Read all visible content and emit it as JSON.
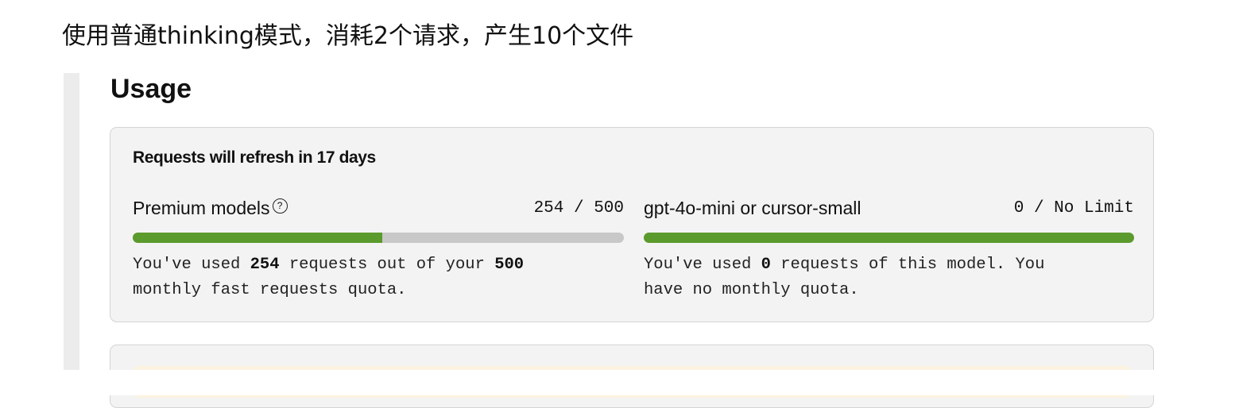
{
  "caption": "使用普通thinking模式，消耗2个请求，产生10个文件",
  "usage": {
    "title": "Usage",
    "refresh_text": "Requests will refresh in 17 days",
    "premium": {
      "name": "Premium models",
      "help_icon": "?",
      "count": "254 / 500",
      "progress_fraction": 0.508,
      "desc_line1_pre": "You've used ",
      "desc_used": "254",
      "desc_line1_mid": " requests out of your ",
      "desc_quota": "500",
      "desc_line2": "monthly fast requests quota."
    },
    "mini": {
      "name": "gpt-4o-mini or cursor-small",
      "count": "0 / No Limit",
      "progress_fraction": 1.0,
      "desc_line1_pre": "You've used ",
      "desc_used": "0",
      "desc_line1_post": " requests of this model. You",
      "desc_line2": "have no monthly quota."
    }
  },
  "colors": {
    "bar_fill": "#5b9a2c",
    "bar_track": "#c8c8c8",
    "card_bg": "#f3f3f3"
  }
}
